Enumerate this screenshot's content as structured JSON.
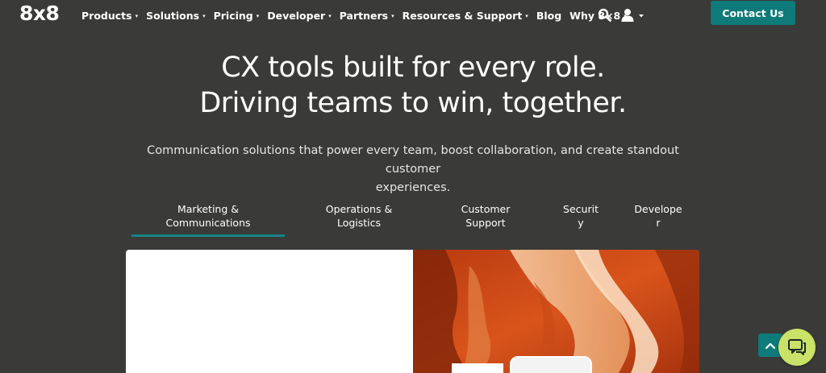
{
  "brand": {
    "logo_text": "8x8"
  },
  "nav": {
    "items": [
      {
        "label": "Products",
        "has_caret": true
      },
      {
        "label": "Solutions",
        "has_caret": true
      },
      {
        "label": "Pricing",
        "has_caret": true
      },
      {
        "label": "Developer",
        "has_caret": true
      },
      {
        "label": "Partners",
        "has_caret": true
      },
      {
        "label": "Resources & Support",
        "has_caret": true
      },
      {
        "label": "Blog",
        "has_caret": false
      },
      {
        "label": "Why 8×8",
        "has_caret": true
      }
    ],
    "caret_glyph": "▾",
    "search_icon": "search-icon",
    "user_icon": "user-icon",
    "contact_label": "Contact Us"
  },
  "hero": {
    "title_line1": "CX tools built for every role.",
    "title_line2": "Driving teams to win, together.",
    "subtitle_line1": "Communication solutions that power every team, boost collaboration, and create standout customer",
    "subtitle_line2": "experiences."
  },
  "tabs": [
    {
      "line1": "Marketing &",
      "line2": "Communications",
      "active": true
    },
    {
      "line1": "Operations &",
      "line2": "Logistics",
      "active": false
    },
    {
      "line1": "Customer",
      "line2": "Support",
      "active": false
    },
    {
      "line1": "Securit",
      "line2": "y",
      "active": false
    },
    {
      "line1": "Develope",
      "line2": "r",
      "active": false
    }
  ],
  "colors": {
    "background": "#3a3a38",
    "accent_teal": "#0f7a7a",
    "chat_green": "#c9e267",
    "tab_underline": "#148585"
  },
  "widgets": {
    "scroll_top_icon": "chevron-up-icon",
    "chat_icon": "chat-icon"
  }
}
